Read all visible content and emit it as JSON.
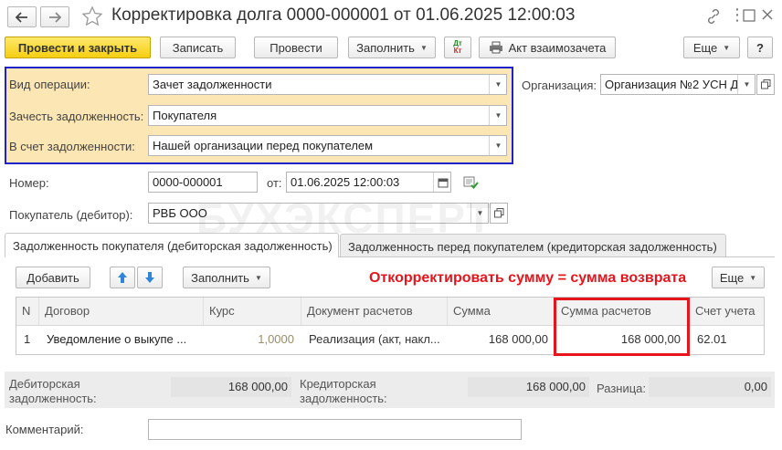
{
  "window": {
    "title": "Корректировка долга 0000-000001 от 01.06.2025 12:00:03"
  },
  "toolbar": {
    "post_close": "Провести и закрыть",
    "save": "Записать",
    "post": "Провести",
    "fill": "Заполнить",
    "dtkt_top": "Дт",
    "dtkt_bottom": "Кт",
    "act": "Акт взаимозачета",
    "more": "Еще",
    "help": "?"
  },
  "form": {
    "op_type_label": "Вид операции:",
    "op_type_value": "Зачет задолженности",
    "offset_label": "Зачесть задолженность:",
    "offset_value": "Покупателя",
    "against_label": "В счет задолженности:",
    "against_value": "Нашей организации перед покупателем",
    "org_label": "Организация:",
    "org_value": "Организация №2 УСН Д",
    "number_label": "Номер:",
    "number_value": "0000-000001",
    "date_label": "от:",
    "date_value": "01.06.2025 12:00:03",
    "buyer_label": "Покупатель (дебитор):",
    "buyer_value": "РВБ ООО"
  },
  "watermark": "БУХЭКСПЕРТ",
  "tabs": [
    {
      "label": "Задолженность покупателя (дебиторская задолженность)"
    },
    {
      "label": "Задолженность перед покупателем (кредиторская задолженность)"
    }
  ],
  "table_toolbar": {
    "add": "Добавить",
    "fill": "Заполнить",
    "more": "Еще"
  },
  "annotation": "Откорректировать сумму = сумма возврата",
  "annotation_color": "#e8141c",
  "table": {
    "columns": [
      "N",
      "Договор",
      "Курс",
      "Документ расчетов",
      "Сумма",
      "Сумма расчетов",
      "Счет учета"
    ],
    "rows": [
      [
        "1",
        "Уведомление о выкупе ...",
        "1,0000",
        "Реализация (акт, накл...",
        "168 000,00",
        "168 000,00",
        "62.01"
      ]
    ]
  },
  "totals": {
    "debit_label_1": "Дебиторская",
    "debit_label_2": "задолженность:",
    "debit_value": "168 000,00",
    "credit_label_1": "Кредиторская",
    "credit_label_2": "задолженность:",
    "credit_value": "168 000,00",
    "diff_label": "Разница:",
    "diff_value": "0,00"
  },
  "comment": {
    "label": "Комментарий:",
    "value": ""
  },
  "colors": {
    "highlight_group_bg": "#fbe6b4",
    "highlight_group_border": "#1e22c8",
    "primary_button": "#f6cf12",
    "totals_bg": "#ececec"
  }
}
